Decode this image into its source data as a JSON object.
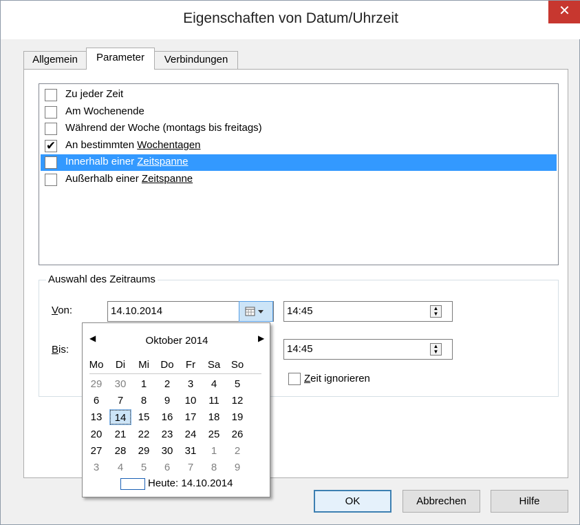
{
  "window": {
    "title": "Eigenschaften von Datum/Uhrzeit",
    "close_glyph": "✕"
  },
  "tabs": [
    {
      "label": "Allgemein"
    },
    {
      "label": "Parameter",
      "active": true
    },
    {
      "label": "Verbindungen"
    }
  ],
  "options": [
    {
      "text": "Zu jeder Zeit",
      "link": "",
      "checked": false,
      "selected": false
    },
    {
      "text": "Am Wochenende",
      "link": "",
      "checked": false,
      "selected": false
    },
    {
      "text": "Während der Woche (montags bis freitags)",
      "link": "",
      "checked": false,
      "selected": false
    },
    {
      "text": "An bestimmten ",
      "link": "Wochentagen",
      "checked": true,
      "selected": false
    },
    {
      "text": "Innerhalb einer ",
      "link": "Zeitspanne",
      "checked": false,
      "selected": true
    },
    {
      "text": "Außerhalb einer ",
      "link": "Zeitspanne",
      "checked": false,
      "selected": false
    }
  ],
  "checkmark": "✔",
  "range": {
    "title": "Auswahl des Zeitraums",
    "from_label_hotkey": "V",
    "from_label_rest": "on:",
    "to_label_hotkey": "B",
    "to_label_rest": "is:",
    "from_date": "14.10.2014",
    "from_time": "14:45",
    "to_time": "14:45",
    "ignore_hotkey": "Z",
    "ignore_rest": "eit ignorieren",
    "ignore_checked": false
  },
  "calendar": {
    "month": "Oktober 2014",
    "prev": "◀",
    "next": "▶",
    "weekdays": [
      "Mo",
      "Di",
      "Mi",
      "Do",
      "Fr",
      "Sa",
      "So"
    ],
    "weeks": [
      [
        "29",
        "30",
        "1",
        "2",
        "3",
        "4",
        "5"
      ],
      [
        "6",
        "7",
        "8",
        "9",
        "10",
        "11",
        "12"
      ],
      [
        "13",
        "14",
        "15",
        "16",
        "17",
        "18",
        "19"
      ],
      [
        "20",
        "21",
        "22",
        "23",
        "24",
        "25",
        "26"
      ],
      [
        "27",
        "28",
        "29",
        "30",
        "31",
        "1",
        "2"
      ],
      [
        "3",
        "4",
        "5",
        "6",
        "7",
        "8",
        "9"
      ]
    ],
    "selected_day": "14",
    "today_label": "Heute: 14.10.2014"
  },
  "buttons": {
    "ok": "OK",
    "cancel": "Abbrechen",
    "help": "Hilfe"
  },
  "colors": {
    "selection": "#3399ff",
    "close": "#c7372f"
  }
}
